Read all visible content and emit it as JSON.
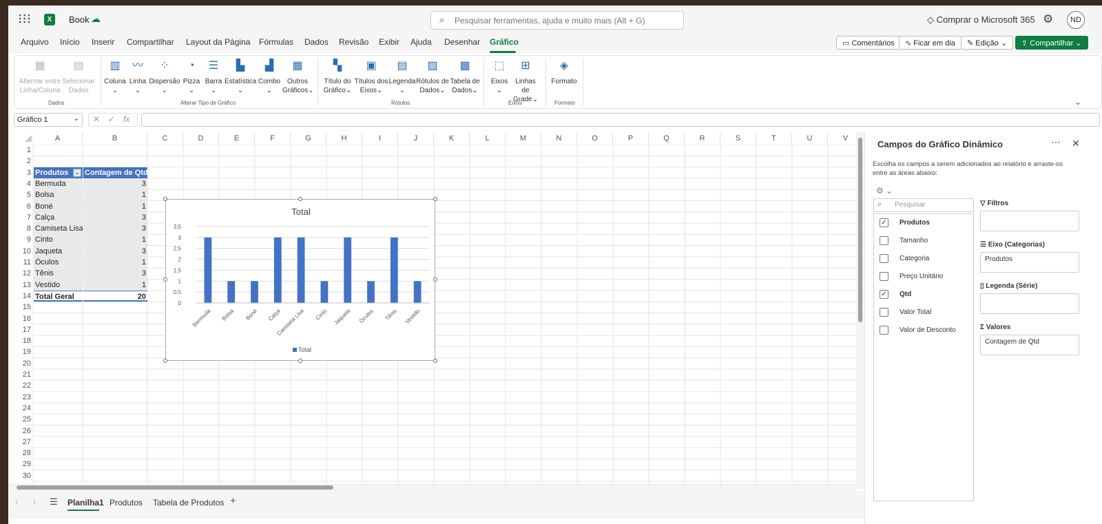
{
  "app": {
    "name": "Book"
  },
  "search": {
    "placeholder": "Pesquisar ferramentas, ajuda e muito mais (Alt + G)"
  },
  "header": {
    "buy": "Comprar o Microsoft 365",
    "avatar": "ND"
  },
  "menu": [
    "Arquivo",
    "Início",
    "Inserir",
    "Compartilhar",
    "Layout da Página",
    "Fórmulas",
    "Dados",
    "Revisão",
    "Exibir",
    "Ajuda",
    "Desenhar",
    "Gráfico"
  ],
  "actions": {
    "comments": "Comentários",
    "catchup": "Ficar em dia",
    "editing": "Edição",
    "share": "Compartilhar"
  },
  "ribbon": {
    "dados": {
      "switch1": "Alternar entre",
      "switch2": "Linha/Coluna",
      "select1": "Selecionar",
      "select2": "Dados",
      "group": "Dados"
    },
    "tipo": {
      "coluna": "Coluna",
      "linha": "Linha",
      "dispersao": "Dispersão",
      "pizza": "Pizza",
      "barra": "Barra",
      "estatistica": "Estatística",
      "combo": "Combo",
      "outros1": "Outros",
      "outros2": "Gráficos",
      "group": "Alterar Tipo de Gráfico"
    },
    "rotulos": {
      "titulo1": "Título do",
      "titulo2": "Gráfico",
      "titulos1": "Títulos dos",
      "titulos2": "Eixos",
      "legenda": "Legenda",
      "rot1": "Rótulos de",
      "rot2": "Dados",
      "tab1": "Tabela de",
      "tab2": "Dados",
      "group": "Rótulos"
    },
    "eixos": {
      "eixos": "Eixos",
      "linhas1": "Linhas de",
      "linhas2": "Grade",
      "group": "Eixos"
    },
    "formato": {
      "formato": "Formato",
      "group": "Formato"
    }
  },
  "namebox": "Gráfico 1",
  "columns": [
    "A",
    "B",
    "C",
    "D",
    "E",
    "F",
    "G",
    "H",
    "I",
    "J",
    "K",
    "L",
    "M",
    "N",
    "O",
    "P",
    "Q",
    "R",
    "S",
    "T",
    "U",
    "V"
  ],
  "pivot": {
    "header": [
      "Produtos",
      "Contagem de Qtd"
    ],
    "rows": [
      [
        "Bermuda",
        "3"
      ],
      [
        "Bolsa",
        "1"
      ],
      [
        "Boné",
        "1"
      ],
      [
        "Calça",
        "3"
      ],
      [
        "Camiseta Lisa",
        "3"
      ],
      [
        "Cinto",
        "1"
      ],
      [
        "Jaqueta",
        "3"
      ],
      [
        "Óculos",
        "1"
      ],
      [
        "Tênis",
        "3"
      ],
      [
        "Vestido",
        "1"
      ]
    ],
    "total": [
      "Total Geral",
      "20"
    ]
  },
  "chart_data": {
    "type": "bar",
    "title": "Total",
    "categories": [
      "Bermuda",
      "Bolsa",
      "Boné",
      "Calça",
      "Camiseta Lisa",
      "Cinto",
      "Jaqueta",
      "Óculos",
      "Tênis",
      "Vestido"
    ],
    "series": [
      {
        "name": "Total",
        "values": [
          3,
          1,
          1,
          3,
          3,
          1,
          3,
          1,
          3,
          1
        ],
        "color": "#4472c4"
      }
    ],
    "ylim": [
      0,
      3.5
    ],
    "yticks": [
      "0",
      "0,5",
      "1",
      "1,5",
      "2",
      "2,5",
      "3",
      "3,5"
    ],
    "grid": true,
    "legend": "bottom"
  },
  "pane": {
    "title": "Campos do Gráfico Dinâmico",
    "desc1": "Escolha os campos a serem adicionados ao relatório e arraste-os",
    "desc2": "entre as áreas abaixo:",
    "search_placeholder": "Pesquisar",
    "fields": [
      {
        "label": "Produtos",
        "checked": true
      },
      {
        "label": "Tamanho",
        "checked": false
      },
      {
        "label": "Categoria",
        "checked": false
      },
      {
        "label": "Preço Unitário",
        "checked": false
      },
      {
        "label": "Qtd",
        "checked": true
      },
      {
        "label": "Valor Total",
        "checked": false
      },
      {
        "label": "Valor de Desconto",
        "checked": false
      }
    ],
    "areas": {
      "filtros": "Filtros",
      "eixo": "Eixo (Categorias)",
      "eixo_val": "Produtos",
      "legenda": "Legenda (Série)",
      "valores": "Valores",
      "valores_val": "Contagem de Qtd"
    }
  },
  "sheets": [
    "Planilha1",
    "Produtos",
    "Tabela de Produtos"
  ]
}
